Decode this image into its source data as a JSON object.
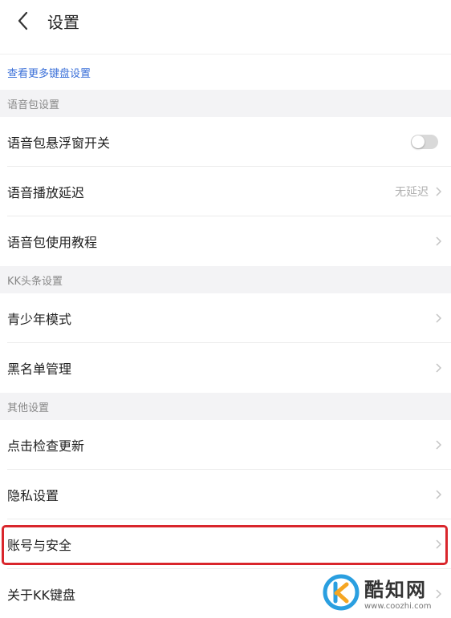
{
  "header": {
    "title": "设置",
    "back_icon": "chevron-left-icon"
  },
  "more_link": "查看更多键盘设置",
  "sections": {
    "voice": {
      "title": "语音包设置",
      "items": [
        {
          "label": "语音包悬浮窗开关",
          "control": "toggle",
          "toggle_on": false
        },
        {
          "label": "语音播放延迟",
          "value": "无延迟"
        },
        {
          "label": "语音包使用教程"
        }
      ]
    },
    "kk": {
      "title": "KK头条设置",
      "items": [
        {
          "label": "青少年模式"
        },
        {
          "label": "黑名单管理"
        }
      ]
    },
    "other": {
      "title": "其他设置",
      "items": [
        {
          "label": "点击检查更新"
        },
        {
          "label": "隐私设置"
        },
        {
          "label": "账号与安全"
        },
        {
          "label": "关于KK键盘"
        }
      ]
    }
  },
  "watermark": {
    "name": "酷知网",
    "url": "www.coozhi.com"
  },
  "colors": {
    "link": "#3a6fd8",
    "section_bg": "#f3f3f5",
    "highlight": "#d9262c",
    "logo_blue": "#2a9fe0",
    "logo_orange": "#f5a623"
  }
}
